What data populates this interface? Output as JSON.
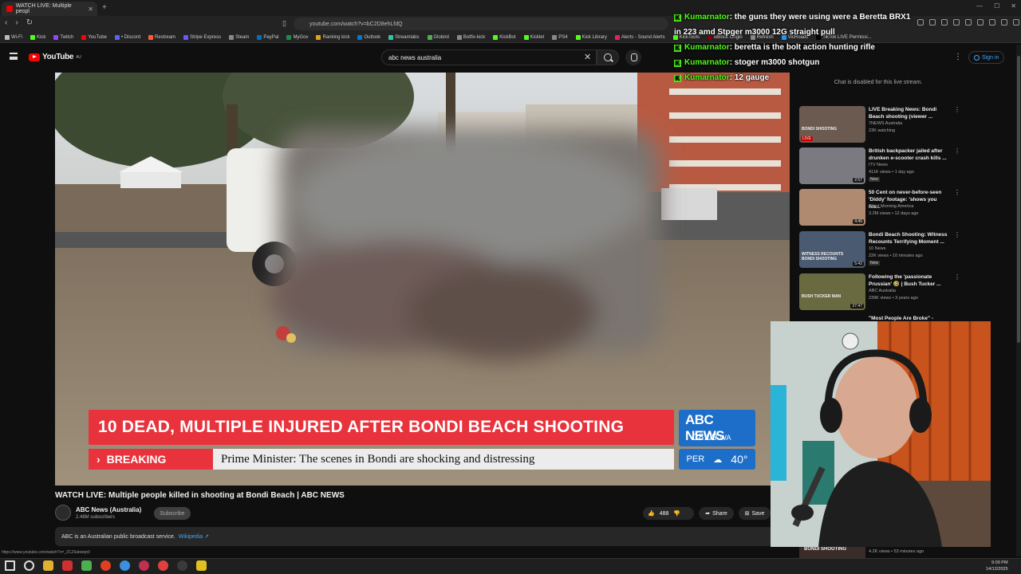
{
  "browser": {
    "tab_title": "WATCH LIVE: Multiple peopl",
    "url": "youtube.com/watch?v=bC2D8ehLfdQ",
    "bookmarks": [
      "Wi-Fi",
      "Kick",
      "Twitch",
      "YouTube",
      "• Discord",
      "Restream",
      "Stripe Express",
      "Steam",
      "PayPal",
      "MyGov",
      "Ranking kick",
      "Outlook",
      "Streamlabs",
      "Globird",
      "Botfix-kick",
      "KickBot",
      "Kicklet",
      "PS4",
      "Kick Library",
      "Alerts - Sound Alerts",
      "KickTools",
      "uBlock Origin",
      "Refresh",
      "VicRoads",
      "TikTok LIVE Permissi..."
    ],
    "status_url": "https://www.youtube.com/watch?v=_2CZ6abwqo0"
  },
  "masthead": {
    "logo_text": "YouTube",
    "logo_region": "AU",
    "search_value": "abc news australia",
    "signin_label": "Sign in"
  },
  "player": {
    "lower_third_headline": "10 DEAD, MULTIPLE INJURED AFTER BONDI BEACH SHOOTING",
    "breaking_label": "BREAKING",
    "ticker_text": "Prime Minister: The scenes in Bondi are shocking and distressing",
    "abc_brand": "ABC NEWS",
    "abc_time": "18:09",
    "abc_tz": "WA",
    "weather_city": "PER",
    "weather_temp": "40°"
  },
  "video": {
    "title": "WATCH LIVE: Multiple people killed in shooting at Bondi Beach | ABC NEWS",
    "channel": "ABC News (Australia)",
    "subscribers": "2.48M subscribers",
    "subscribe_label": "Subscribe",
    "likes": "488",
    "share_label": "Share",
    "save_label": "Save",
    "description": "ABC is an Australian public broadcast service.",
    "description_link": "Wikipedia ↗"
  },
  "sidebar": {
    "chat_disabled": "Chat is disabled for this live stream.",
    "recommendations": [
      {
        "title": "LIVE Breaking News: Bondi Beach shooting (viewer ...",
        "channel": "7NEWS Australia",
        "meta": "23K watching",
        "badge": "LIVE",
        "thumb_text": "BONDI SHOOTING",
        "new": ""
      },
      {
        "title": "British backpacker jailed after drunken e-scooter crash kills ...",
        "channel": "ITV News",
        "meta": "411K views • 1 day ago",
        "badge": "2:57",
        "thumb_text": "",
        "new": "New"
      },
      {
        "title": "50 Cent on never-before-seen 'Diddy' footage: 'shows you his...",
        "channel": "Good Morning America",
        "meta": "3.2M views • 12 days ago",
        "badge": "4:46",
        "thumb_text": "",
        "new": ""
      },
      {
        "title": "Bondi Beach Shooting: Witness Recounts Terrifying Moment ...",
        "channel": "10 News",
        "meta": "22K views • 10 minutes ago",
        "badge": "5:42",
        "thumb_text": "WITNESS RECOUNTS BONDI SHOOTING",
        "new": "New"
      },
      {
        "title": "Following the 'passionate Prussian' 🤣 | Bush Tucker ...",
        "channel": "ABC Australia",
        "meta": "239K views • 3 years ago",
        "badge": "27:47",
        "thumb_text": "BUSH TUCKER MAN",
        "new": ""
      }
    ],
    "partial_title": "\"Most People Are Broke\" -",
    "bottom_thumb_text": "BONDI SHOOTING",
    "bottom_meta": "4.2K views • 53 minutes ago",
    "bottom_dur": "8:54"
  },
  "chat_overlay": [
    {
      "user": "Kumarnator",
      "text": ": the guns they were using were a Beretta BRX1 in 223 amd Stpger m3000 12G straight pull"
    },
    {
      "user": "Kumarnator",
      "text": ": beretta is the bolt action hunting rifle"
    },
    {
      "user": "Kumarnator",
      "text": ": stoger m3000 shotgun"
    },
    {
      "user": "Kumarnator",
      "text": ": 12 gauge"
    }
  ],
  "taskbar": {
    "time": "9:09 PM",
    "date": "14/12/2025"
  },
  "colors": {
    "abc_red": "#e8323c",
    "abc_blue": "#1c6ec8",
    "kick_green": "#53fc18",
    "yt_red": "#ff0000",
    "link_blue": "#3ea6ff"
  }
}
